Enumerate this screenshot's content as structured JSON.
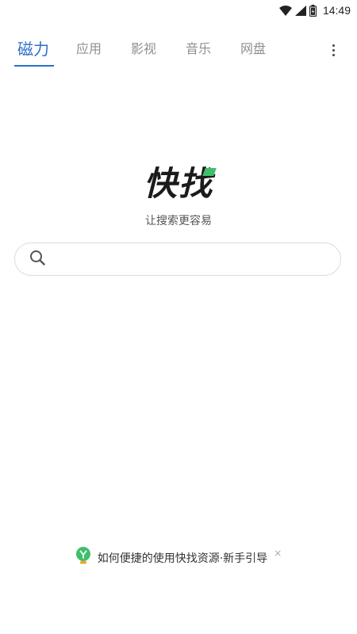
{
  "status_bar": {
    "time": "14:49",
    "icons": [
      "wifi-icon",
      "signal-icon",
      "battery-icon"
    ]
  },
  "tabs": [
    {
      "label": "磁力",
      "active": true
    },
    {
      "label": "应用",
      "active": false
    },
    {
      "label": "影视",
      "active": false
    },
    {
      "label": "音乐",
      "active": false
    },
    {
      "label": "网盘",
      "active": false
    }
  ],
  "logo": {
    "text": "快找",
    "slogan": "让搜索更容易"
  },
  "search": {
    "placeholder": "",
    "value": ""
  },
  "guide": {
    "text": "如何便捷的使用快找资源·新手引导",
    "close_label": "×"
  },
  "colors": {
    "accent": "#2f6ec8",
    "logo_green": "#3fbf6a"
  }
}
